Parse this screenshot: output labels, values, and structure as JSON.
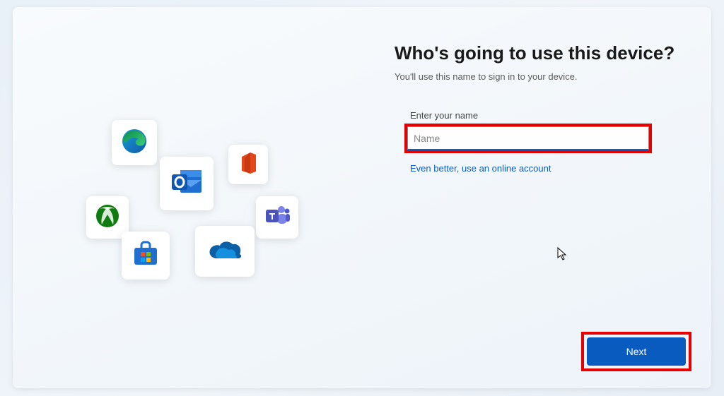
{
  "setup": {
    "title": "Who's going to use this device?",
    "subtitle": "You'll use this name to sign in to your device.",
    "field_label": "Enter your name",
    "name_placeholder": "Name",
    "name_value": "",
    "online_link": "Even better, use an online account",
    "next_label": "Next"
  },
  "tiles": {
    "edge": "edge-icon",
    "office": "office-icon",
    "outlook": "outlook-icon",
    "xbox": "xbox-icon",
    "teams": "teams-icon",
    "store": "store-icon",
    "onedrive": "onedrive-icon"
  },
  "colors": {
    "accent": "#0a5bbf",
    "highlight": "#e60000"
  }
}
